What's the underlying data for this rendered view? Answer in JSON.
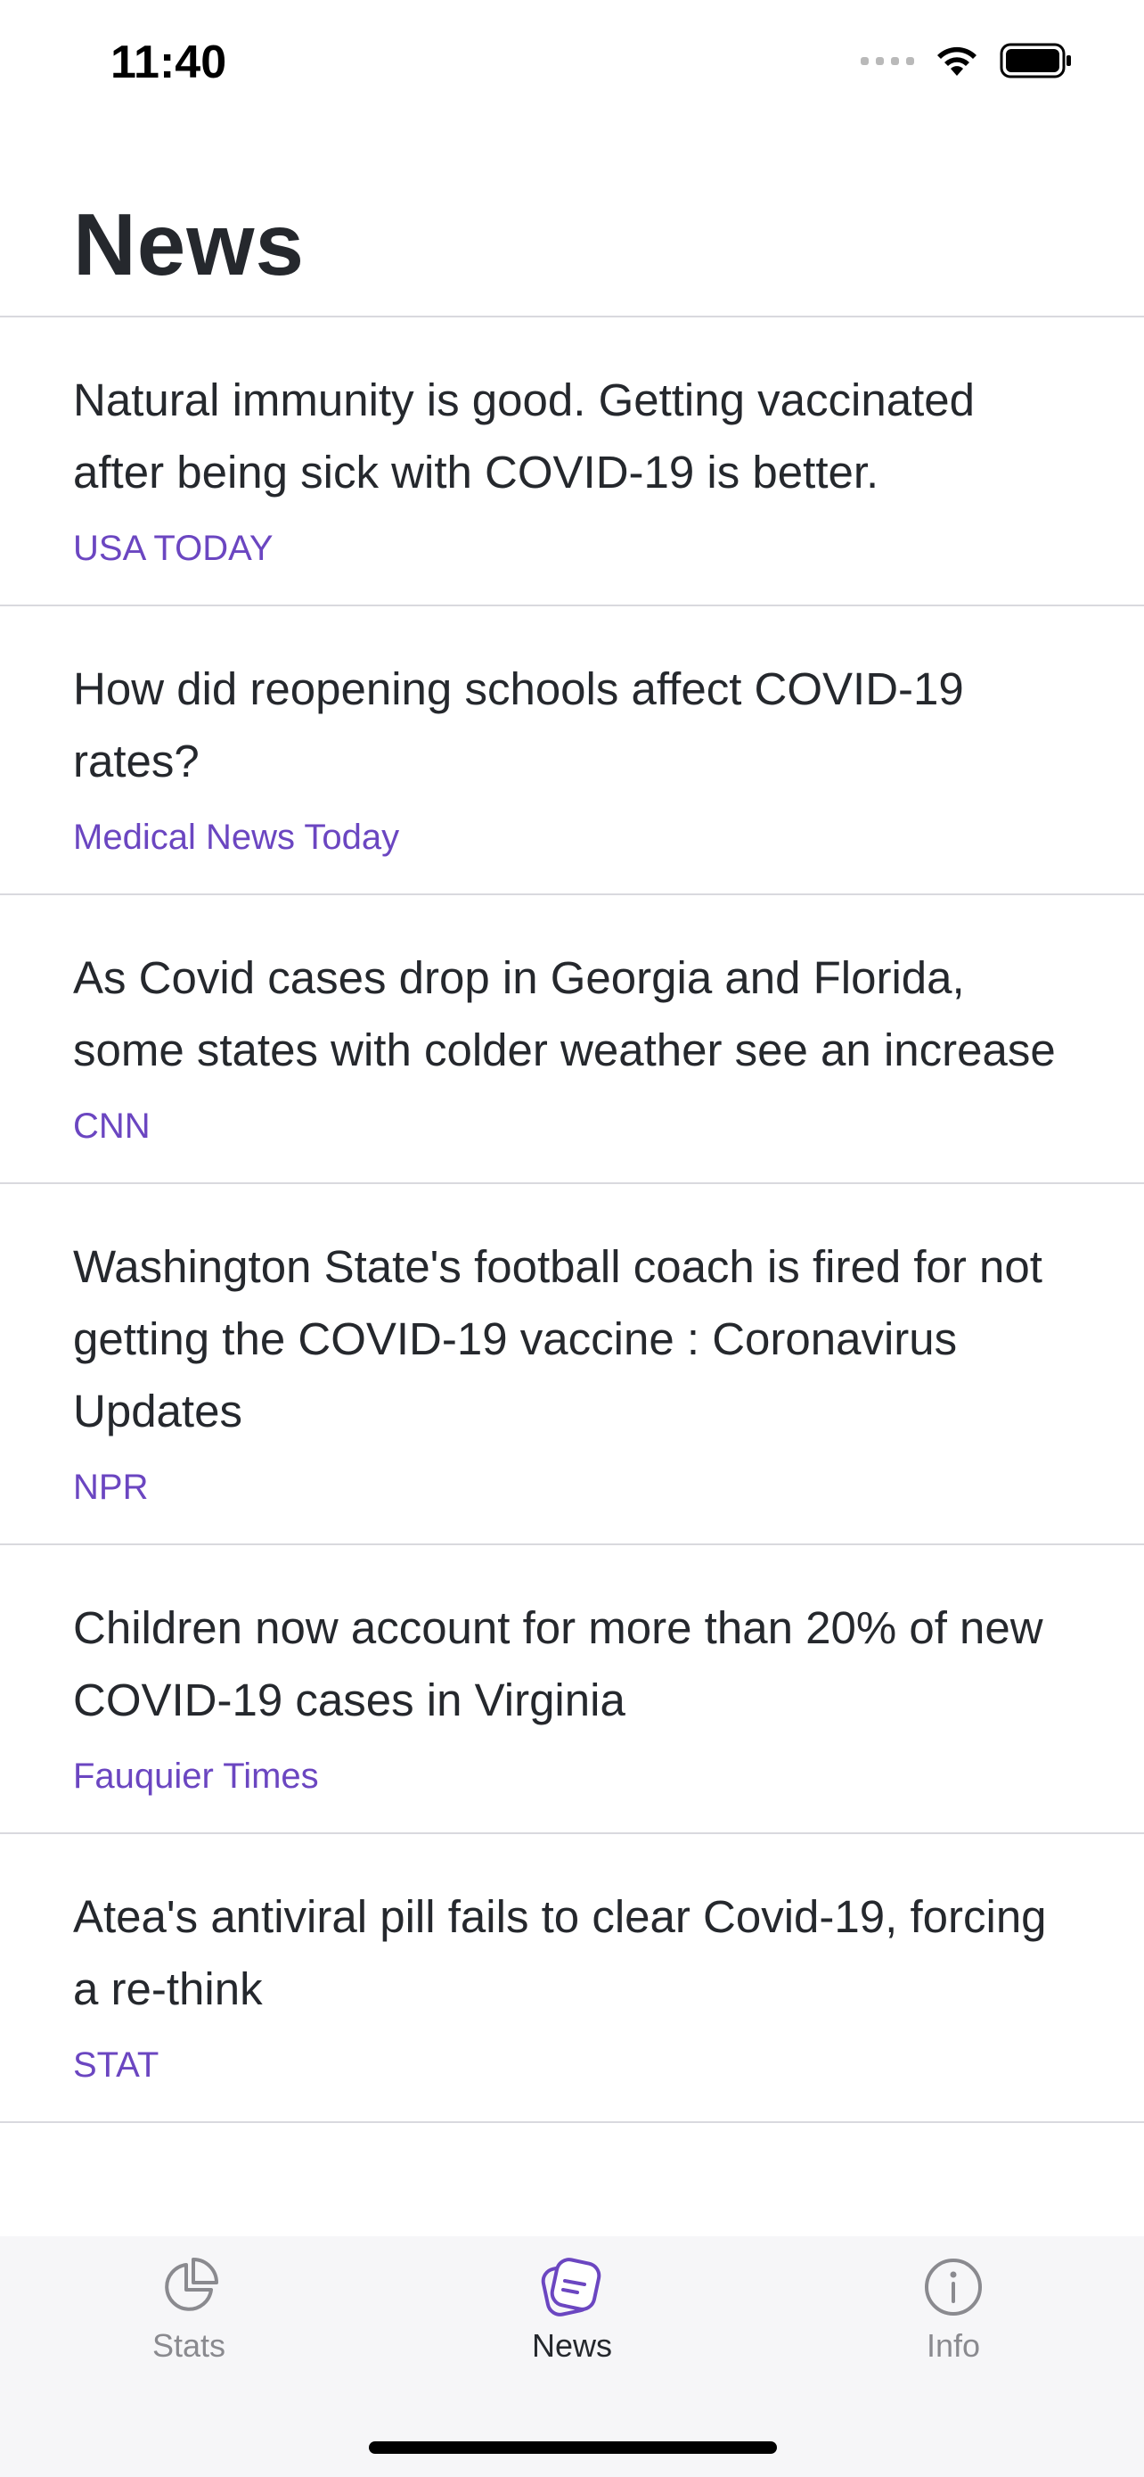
{
  "status_bar": {
    "time": "11:40"
  },
  "header": {
    "title": "News"
  },
  "articles": [
    {
      "headline": "Natural immunity is good. Getting vaccinated after being sick with COVID-19 is better.",
      "source": "USA TODAY"
    },
    {
      "headline": "How did reopening schools affect COVID-19 rates?",
      "source": "Medical News Today"
    },
    {
      "headline": "As Covid cases drop in Georgia and Florida, some states with colder weather see an increase",
      "source": "CNN"
    },
    {
      "headline": "Washington State's football coach is fired for not getting the COVID-19 vaccine : Coronavirus Updates",
      "source": "NPR"
    },
    {
      "headline": "Children now account for more than 20% of new COVID-19 cases in Virginia",
      "source": "Fauquier Times"
    },
    {
      "headline": "Atea's antiviral pill fails to clear Covid-19, forcing a re-think",
      "source": "STAT"
    }
  ],
  "tab_bar": {
    "active_tab": "News",
    "tabs": [
      {
        "label": "Stats",
        "icon": "pie-chart-icon"
      },
      {
        "label": "News",
        "icon": "news-icon"
      },
      {
        "label": "Info",
        "icon": "info-icon"
      }
    ]
  },
  "colors": {
    "accent": "#6b46c1",
    "text": "#25282d",
    "inactive": "#8a8a8f"
  }
}
